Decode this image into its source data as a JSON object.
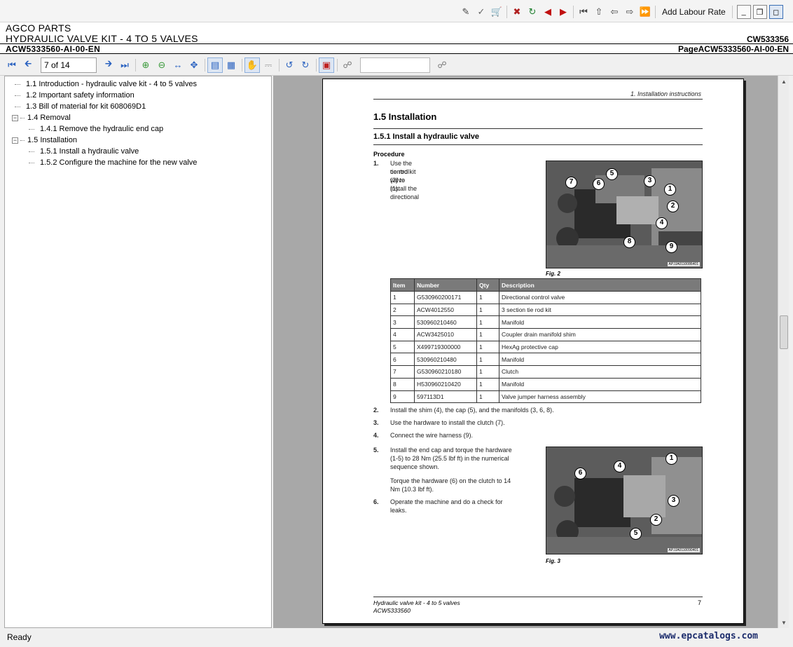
{
  "toolbar": {
    "add_labour_rate": "Add Labour Rate",
    "icons": [
      "edit-icon",
      "checkmark-icon",
      "cart-icon",
      "cart-remove-icon",
      "cart-refresh-icon",
      "arrow-left-red-icon",
      "arrow-right-red-icon",
      "first-page-icon",
      "up-icon",
      "back-icon",
      "forward-icon",
      "fast-forward-icon"
    ]
  },
  "header": {
    "line1": "AGCO PARTS",
    "line2": "HYDRAULIC VALVE KIT - 4 TO 5 VALVES",
    "line2_right": "CW533356",
    "line3": "ACW5333560-AI-00-EN",
    "line3_right": "PageACW5333560-AI-00-EN"
  },
  "viewer_toolbar": {
    "page_value": "7 of 14"
  },
  "tree": {
    "items": [
      {
        "label": "1.1 Introduction - hydraulic valve kit - 4 to 5 valves",
        "level": 0,
        "toggle": ""
      },
      {
        "label": "1.2 Important safety information",
        "level": 0,
        "toggle": ""
      },
      {
        "label": "1.3 Bill of material for kit 608069D1",
        "level": 0,
        "toggle": ""
      },
      {
        "label": "1.4 Removal",
        "level": 0,
        "toggle": "−"
      },
      {
        "label": "1.4.1 Remove the hydraulic end cap",
        "level": 1,
        "toggle": ""
      },
      {
        "label": "1.5 Installation",
        "level": 0,
        "toggle": "−"
      },
      {
        "label": "1.5.1 Install a hydraulic valve",
        "level": 1,
        "toggle": ""
      },
      {
        "label": "1.5.2 Configure the machine for the new valve",
        "level": 1,
        "toggle": ""
      }
    ]
  },
  "document": {
    "header_right": "1. Installation instructions",
    "h1": "1.5   Installation",
    "h2": "1.5.1  Install a hydraulic valve",
    "procedure": "Procedure",
    "step1_num": "1.",
    "step1_l1": "Use the tie rod kit (2) to install the directional",
    "step1_l2": "control valve (1).",
    "fig2_code": "APJJA0110086401",
    "fig2_caption": "Fig. 2",
    "fig2_callouts": [
      "5",
      "3",
      "7",
      "6",
      "1",
      "2",
      "4",
      "8",
      "9"
    ],
    "table": {
      "headers": [
        "Item",
        "Number",
        "Qty",
        "Description"
      ],
      "rows": [
        [
          "1",
          "G530960200171",
          "1",
          "Directional control valve"
        ],
        [
          "2",
          "ACW4012550",
          "1",
          "3 section tie rod kit"
        ],
        [
          "3",
          "530960210460",
          "1",
          "Manifold"
        ],
        [
          "4",
          "ACW3425010",
          "1",
          "Coupler drain manifold shim"
        ],
        [
          "5",
          "X499719300000",
          "1",
          "HexAg protective cap"
        ],
        [
          "6",
          "530960210480",
          "1",
          "Manifold"
        ],
        [
          "7",
          "G530960210180",
          "1",
          "Clutch"
        ],
        [
          "8",
          "H530960210420",
          "1",
          "Manifold"
        ],
        [
          "9",
          "597113D1",
          "1",
          "Valve jumper harness assembly"
        ]
      ]
    },
    "step2_num": "2.",
    "step2": "Install the shim (4), the cap (5), and the manifolds (3, 6, 8).",
    "step3_num": "3.",
    "step3": "Use the hardware to install the clutch (7).",
    "step4_num": "4.",
    "step4": "Connect the wire harness (9).",
    "step5_num": "5.",
    "step5_l1": "Install the end cap and torque the hardware",
    "step5_l2": "(1-5) to 28 Nm (25.5 lbf ft) in the numerical",
    "step5_l3": "sequence shown.",
    "step5_l4": "Torque the hardware (6) on the clutch to 14",
    "step5_l5": "Nm (10.3 lbf ft).",
    "step6_num": "6.",
    "step6_l1": "Operate the machine and do a check for",
    "step6_l2": "leaks.",
    "fig3_code": "APJJA0110090401",
    "fig3_caption": "Fig. 3",
    "fig3_callouts": [
      "1",
      "4",
      "6",
      "3",
      "2",
      "5"
    ],
    "footer_l1": "Hydraulic valve kit - 4 to 5 valves",
    "footer_l2": "ACW5333560",
    "footer_page": "7"
  },
  "status": {
    "text": "Ready",
    "watermark": "www.epcatalogs.com"
  }
}
